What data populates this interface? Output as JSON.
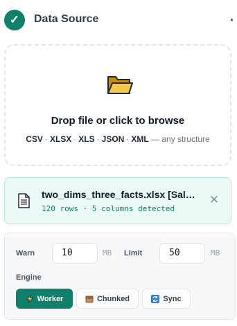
{
  "section": {
    "title": "Data Source",
    "check_glyph": "✓",
    "collapse_glyph": "▲",
    "accent_color": "#11806a"
  },
  "dropzone": {
    "icon": "folder-icon",
    "headline": "Drop file or click to browse",
    "formats": [
      "CSV",
      "XLSX",
      "XLS",
      "JSON",
      "XML"
    ],
    "format_separator": "·",
    "suffix": "— any structure"
  },
  "file": {
    "icon": "document-icon",
    "name": "two_dims_three_facts.xlsx [Sal…",
    "meta": "120 rows · 5 columns detected",
    "remove_glyph": "✕"
  },
  "settings": {
    "warn_label": "Warn",
    "warn_value": "10",
    "warn_unit": "MB",
    "limit_label": "Limit",
    "limit_value": "50",
    "limit_unit": "MB",
    "engine_label": "Engine",
    "engines": [
      {
        "label": "Worker",
        "icon": "lightning-icon",
        "selected": true
      },
      {
        "label": "Chunked",
        "icon": "package-icon",
        "selected": false
      },
      {
        "label": "Sync",
        "icon": "sync-icon",
        "selected": false
      }
    ]
  }
}
